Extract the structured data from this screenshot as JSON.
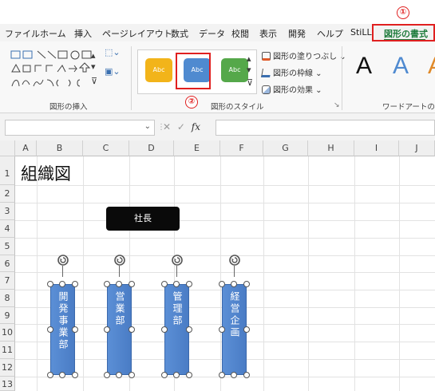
{
  "ribbon": {
    "tabs": [
      "ファイル",
      "ホーム",
      "挿入",
      "ページレイアウト",
      "数式",
      "データ",
      "校閲",
      "表示",
      "開発",
      "ヘルプ",
      "StiLL",
      "図形の書式"
    ],
    "active_tab": "図形の書式",
    "groups": {
      "insert_shapes": "図形の挿入",
      "shape_styles": "図形のスタイル",
      "wordart_styles": "ワードアートのスタ"
    },
    "style_swatches": [
      {
        "label": "Abc",
        "color": "#f2b41a"
      },
      {
        "label": "Abc",
        "color": "#4f8ad0"
      },
      {
        "label": "Abc",
        "color": "#55a84a"
      }
    ],
    "commands": {
      "fill": "図形の塗りつぶし",
      "outline": "図形の枠線",
      "effects": "図形の効果"
    },
    "wordart": [
      {
        "letter": "A",
        "color": "#111111"
      },
      {
        "letter": "A",
        "color": "#4f8ad0"
      },
      {
        "letter": "A",
        "color": "#e08a2a"
      }
    ]
  },
  "annotations": {
    "step1": "①",
    "step2": "②",
    "highlight_color": "#e02020"
  },
  "formula_bar": {
    "cancel": "✕",
    "confirm": "✓",
    "function": "fx"
  },
  "columns": [
    "A",
    "B",
    "C",
    "D",
    "E",
    "F",
    "G",
    "H",
    "I",
    "J"
  ],
  "rows": [
    "1",
    "2",
    "3",
    "4",
    "5",
    "6",
    "7",
    "8",
    "9",
    "10",
    "11",
    "12",
    "13"
  ],
  "sheet": {
    "title": "組織図",
    "ceo": "社長",
    "departments": [
      "開発事業部",
      "営業部",
      "管理部",
      "経営企画"
    ]
  }
}
